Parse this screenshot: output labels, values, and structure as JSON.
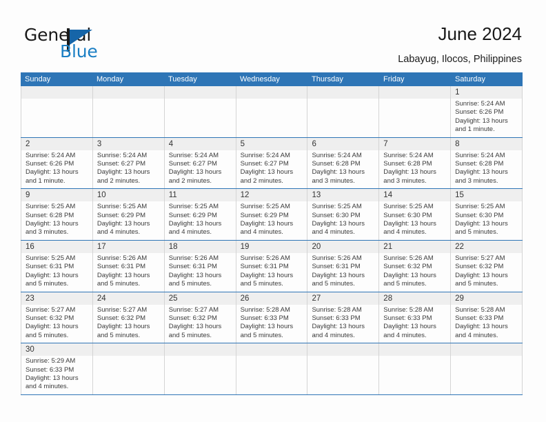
{
  "brand": {
    "name_part1": "General",
    "name_part2": "Blue",
    "accent_color": "#2e75b6",
    "blue_text_color": "#1b7fc4"
  },
  "header": {
    "title": "June 2024",
    "subtitle": "Labayug, Ilocos, Philippines"
  },
  "calendar": {
    "weekdays": [
      "Sunday",
      "Monday",
      "Tuesday",
      "Wednesday",
      "Thursday",
      "Friday",
      "Saturday"
    ],
    "labels": {
      "sunrise": "Sunrise:",
      "sunset": "Sunset:",
      "daylight": "Daylight:"
    },
    "weeks": [
      [
        {
          "day": "",
          "blank": true
        },
        {
          "day": "",
          "blank": true
        },
        {
          "day": "",
          "blank": true
        },
        {
          "day": "",
          "blank": true
        },
        {
          "day": "",
          "blank": true
        },
        {
          "day": "",
          "blank": true
        },
        {
          "day": "1",
          "sunrise": "Sunrise: 5:24 AM",
          "sunset": "Sunset: 6:26 PM",
          "daylight1": "Daylight: 13 hours",
          "daylight2": "and 1 minute."
        }
      ],
      [
        {
          "day": "2",
          "sunrise": "Sunrise: 5:24 AM",
          "sunset": "Sunset: 6:26 PM",
          "daylight1": "Daylight: 13 hours",
          "daylight2": "and 1 minute."
        },
        {
          "day": "3",
          "sunrise": "Sunrise: 5:24 AM",
          "sunset": "Sunset: 6:27 PM",
          "daylight1": "Daylight: 13 hours",
          "daylight2": "and 2 minutes."
        },
        {
          "day": "4",
          "sunrise": "Sunrise: 5:24 AM",
          "sunset": "Sunset: 6:27 PM",
          "daylight1": "Daylight: 13 hours",
          "daylight2": "and 2 minutes."
        },
        {
          "day": "5",
          "sunrise": "Sunrise: 5:24 AM",
          "sunset": "Sunset: 6:27 PM",
          "daylight1": "Daylight: 13 hours",
          "daylight2": "and 2 minutes."
        },
        {
          "day": "6",
          "sunrise": "Sunrise: 5:24 AM",
          "sunset": "Sunset: 6:28 PM",
          "daylight1": "Daylight: 13 hours",
          "daylight2": "and 3 minutes."
        },
        {
          "day": "7",
          "sunrise": "Sunrise: 5:24 AM",
          "sunset": "Sunset: 6:28 PM",
          "daylight1": "Daylight: 13 hours",
          "daylight2": "and 3 minutes."
        },
        {
          "day": "8",
          "sunrise": "Sunrise: 5:24 AM",
          "sunset": "Sunset: 6:28 PM",
          "daylight1": "Daylight: 13 hours",
          "daylight2": "and 3 minutes."
        }
      ],
      [
        {
          "day": "9",
          "sunrise": "Sunrise: 5:25 AM",
          "sunset": "Sunset: 6:28 PM",
          "daylight1": "Daylight: 13 hours",
          "daylight2": "and 3 minutes."
        },
        {
          "day": "10",
          "sunrise": "Sunrise: 5:25 AM",
          "sunset": "Sunset: 6:29 PM",
          "daylight1": "Daylight: 13 hours",
          "daylight2": "and 4 minutes."
        },
        {
          "day": "11",
          "sunrise": "Sunrise: 5:25 AM",
          "sunset": "Sunset: 6:29 PM",
          "daylight1": "Daylight: 13 hours",
          "daylight2": "and 4 minutes."
        },
        {
          "day": "12",
          "sunrise": "Sunrise: 5:25 AM",
          "sunset": "Sunset: 6:29 PM",
          "daylight1": "Daylight: 13 hours",
          "daylight2": "and 4 minutes."
        },
        {
          "day": "13",
          "sunrise": "Sunrise: 5:25 AM",
          "sunset": "Sunset: 6:30 PM",
          "daylight1": "Daylight: 13 hours",
          "daylight2": "and 4 minutes."
        },
        {
          "day": "14",
          "sunrise": "Sunrise: 5:25 AM",
          "sunset": "Sunset: 6:30 PM",
          "daylight1": "Daylight: 13 hours",
          "daylight2": "and 4 minutes."
        },
        {
          "day": "15",
          "sunrise": "Sunrise: 5:25 AM",
          "sunset": "Sunset: 6:30 PM",
          "daylight1": "Daylight: 13 hours",
          "daylight2": "and 5 minutes."
        }
      ],
      [
        {
          "day": "16",
          "sunrise": "Sunrise: 5:25 AM",
          "sunset": "Sunset: 6:31 PM",
          "daylight1": "Daylight: 13 hours",
          "daylight2": "and 5 minutes."
        },
        {
          "day": "17",
          "sunrise": "Sunrise: 5:26 AM",
          "sunset": "Sunset: 6:31 PM",
          "daylight1": "Daylight: 13 hours",
          "daylight2": "and 5 minutes."
        },
        {
          "day": "18",
          "sunrise": "Sunrise: 5:26 AM",
          "sunset": "Sunset: 6:31 PM",
          "daylight1": "Daylight: 13 hours",
          "daylight2": "and 5 minutes."
        },
        {
          "day": "19",
          "sunrise": "Sunrise: 5:26 AM",
          "sunset": "Sunset: 6:31 PM",
          "daylight1": "Daylight: 13 hours",
          "daylight2": "and 5 minutes."
        },
        {
          "day": "20",
          "sunrise": "Sunrise: 5:26 AM",
          "sunset": "Sunset: 6:31 PM",
          "daylight1": "Daylight: 13 hours",
          "daylight2": "and 5 minutes."
        },
        {
          "day": "21",
          "sunrise": "Sunrise: 5:26 AM",
          "sunset": "Sunset: 6:32 PM",
          "daylight1": "Daylight: 13 hours",
          "daylight2": "and 5 minutes."
        },
        {
          "day": "22",
          "sunrise": "Sunrise: 5:27 AM",
          "sunset": "Sunset: 6:32 PM",
          "daylight1": "Daylight: 13 hours",
          "daylight2": "and 5 minutes."
        }
      ],
      [
        {
          "day": "23",
          "sunrise": "Sunrise: 5:27 AM",
          "sunset": "Sunset: 6:32 PM",
          "daylight1": "Daylight: 13 hours",
          "daylight2": "and 5 minutes."
        },
        {
          "day": "24",
          "sunrise": "Sunrise: 5:27 AM",
          "sunset": "Sunset: 6:32 PM",
          "daylight1": "Daylight: 13 hours",
          "daylight2": "and 5 minutes."
        },
        {
          "day": "25",
          "sunrise": "Sunrise: 5:27 AM",
          "sunset": "Sunset: 6:32 PM",
          "daylight1": "Daylight: 13 hours",
          "daylight2": "and 5 minutes."
        },
        {
          "day": "26",
          "sunrise": "Sunrise: 5:28 AM",
          "sunset": "Sunset: 6:33 PM",
          "daylight1": "Daylight: 13 hours",
          "daylight2": "and 5 minutes."
        },
        {
          "day": "27",
          "sunrise": "Sunrise: 5:28 AM",
          "sunset": "Sunset: 6:33 PM",
          "daylight1": "Daylight: 13 hours",
          "daylight2": "and 4 minutes."
        },
        {
          "day": "28",
          "sunrise": "Sunrise: 5:28 AM",
          "sunset": "Sunset: 6:33 PM",
          "daylight1": "Daylight: 13 hours",
          "daylight2": "and 4 minutes."
        },
        {
          "day": "29",
          "sunrise": "Sunrise: 5:28 AM",
          "sunset": "Sunset: 6:33 PM",
          "daylight1": "Daylight: 13 hours",
          "daylight2": "and 4 minutes."
        }
      ],
      [
        {
          "day": "30",
          "sunrise": "Sunrise: 5:29 AM",
          "sunset": "Sunset: 6:33 PM",
          "daylight1": "Daylight: 13 hours",
          "daylight2": "and 4 minutes."
        },
        {
          "day": "",
          "blank": true
        },
        {
          "day": "",
          "blank": true
        },
        {
          "day": "",
          "blank": true
        },
        {
          "day": "",
          "blank": true
        },
        {
          "day": "",
          "blank": true
        },
        {
          "day": "",
          "blank": true
        }
      ]
    ]
  }
}
